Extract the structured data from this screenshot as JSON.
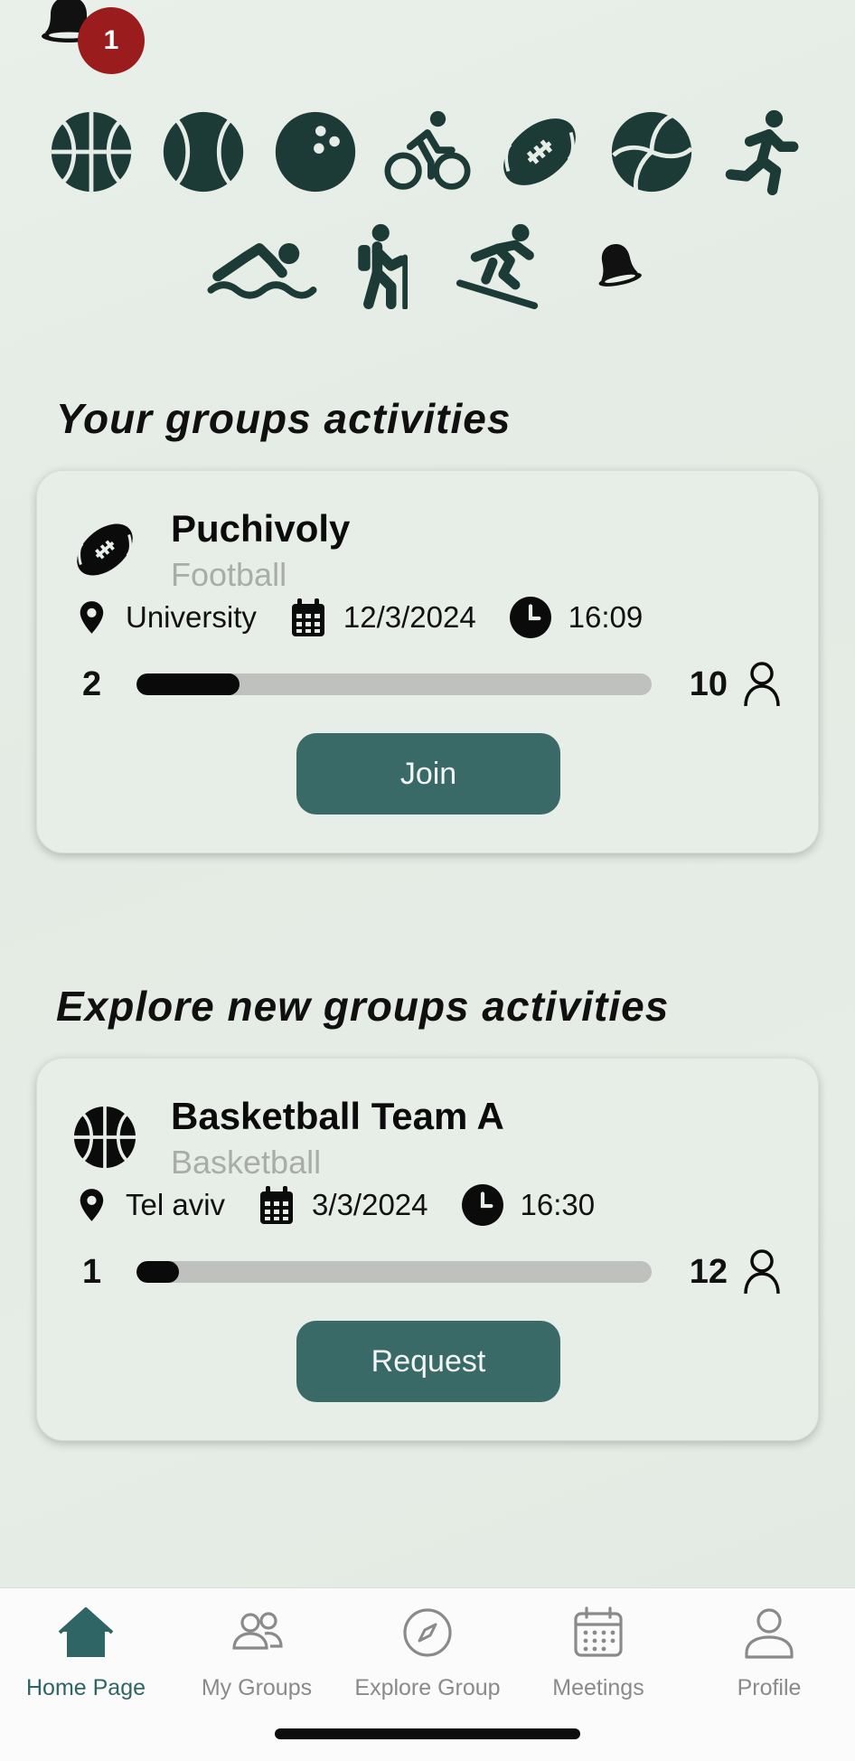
{
  "notification": {
    "badge_count": "1",
    "icon": "bell-icon"
  },
  "sports_icons": {
    "row1": [
      "basketball-icon",
      "tennis-ball-icon",
      "bowling-ball-icon",
      "cycling-icon",
      "football-icon",
      "volleyball-icon",
      "running-icon"
    ],
    "row2": [
      "swimming-icon",
      "hiking-icon",
      "snowboarding-icon",
      "bell-icon"
    ]
  },
  "your_groups": {
    "title": "Your groups activities",
    "card": {
      "name": "Puchivoly",
      "sport": "Football",
      "sport_icon": "football-icon",
      "location": "University",
      "date": "12/3/2024",
      "time": "16:09",
      "current": "2",
      "max": "10",
      "fill_fraction": 0.2,
      "action_label": "Join"
    }
  },
  "explore_groups": {
    "title": "Explore new groups activities",
    "card": {
      "name": "Basketball Team A",
      "sport": "Basketball",
      "sport_icon": "basketball-icon",
      "location": "Tel aviv",
      "date": "3/3/2024",
      "time": "16:30",
      "current": "1",
      "max": "12",
      "fill_fraction": 0.083,
      "action_label": "Request"
    }
  },
  "tabbar": {
    "active_color": "#2f6564",
    "items": [
      {
        "label": "Home Page",
        "icon": "home-icon",
        "active": true
      },
      {
        "label": "My Groups",
        "icon": "group-icon",
        "active": false
      },
      {
        "label": "Explore Group",
        "icon": "compass-icon",
        "active": false
      },
      {
        "label": "Meetings",
        "icon": "calendar-icon",
        "active": false
      },
      {
        "label": "Profile",
        "icon": "user-icon",
        "active": false
      }
    ]
  },
  "colors": {
    "icon_dark": "#1c3a36",
    "button": "#3a6a67",
    "badge": "#9b1c1c"
  }
}
